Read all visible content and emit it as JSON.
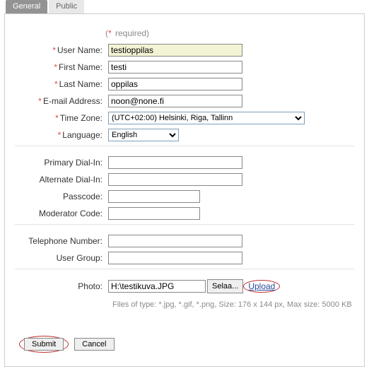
{
  "tabs": {
    "general": "General",
    "public": "Public"
  },
  "required_legend": "required",
  "labels": {
    "username": "User Name:",
    "firstname": "First Name:",
    "lastname": "Last Name:",
    "email": "E-mail Address:",
    "timezone": "Time Zone:",
    "language": "Language:",
    "primary_dial": "Primary Dial-In:",
    "alternate_dial": "Alternate Dial-In:",
    "passcode": "Passcode:",
    "moderator": "Moderator Code:",
    "telephone": "Telephone Number:",
    "usergroup": "User Group:",
    "photo": "Photo:"
  },
  "values": {
    "username": "testioppilas",
    "firstname": "testi",
    "lastname": "oppilas",
    "email": "noon@none.fi",
    "timezone": "(UTC+02:00) Helsinki, Riga, Tallinn",
    "language": "English",
    "primary_dial": "",
    "alternate_dial": "",
    "passcode": "",
    "moderator": "",
    "telephone": "",
    "usergroup": "",
    "photo_path": "H:\\testikuva.JPG"
  },
  "buttons": {
    "browse": "Selaa...",
    "upload": "Upload",
    "submit": "Submit",
    "cancel": "Cancel"
  },
  "hint": "Files of type: *.jpg, *.gif, *.png,  Size: 176 x 144 px,  Max size: 5000 KB"
}
